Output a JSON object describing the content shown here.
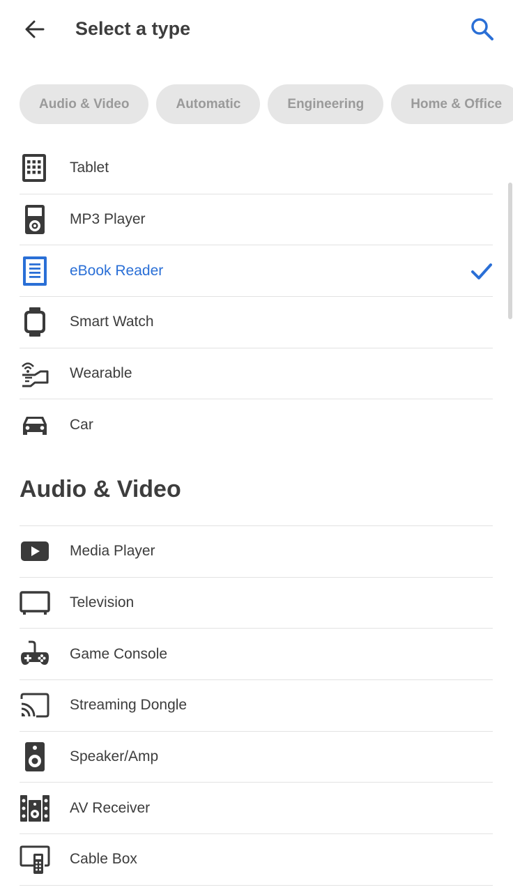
{
  "header": {
    "title": "Select a type",
    "back_icon": "arrow-left-icon",
    "search_icon": "search-icon"
  },
  "chips": [
    {
      "label": "Audio & Video"
    },
    {
      "label": "Automatic"
    },
    {
      "label": "Engineering"
    },
    {
      "label": "Home & Office"
    }
  ],
  "types": [
    {
      "label": "Tablet",
      "icon": "tablet-icon"
    },
    {
      "label": "MP3 Player",
      "icon": "mp3-player-icon"
    },
    {
      "label": "eBook Reader",
      "icon": "ebook-reader-icon",
      "selected": true
    },
    {
      "label": "Smart Watch",
      "icon": "smart-watch-icon"
    },
    {
      "label": "Wearable",
      "icon": "wearable-icon"
    },
    {
      "label": "Car",
      "icon": "car-icon"
    }
  ],
  "sections": [
    {
      "title": "Audio & Video",
      "items": [
        {
          "label": "Media Player",
          "icon": "media-player-icon"
        },
        {
          "label": "Television",
          "icon": "television-icon"
        },
        {
          "label": "Game Console",
          "icon": "game-console-icon"
        },
        {
          "label": "Streaming Dongle",
          "icon": "cast-icon"
        },
        {
          "label": "Speaker/Amp",
          "icon": "speaker-icon"
        },
        {
          "label": "AV Receiver",
          "icon": "av-receiver-icon"
        },
        {
          "label": "Cable Box",
          "icon": "cable-box-icon"
        }
      ]
    }
  ],
  "colors": {
    "accent": "#2a6fd6",
    "text": "#3c3c3c",
    "chip_bg": "#e6e6e6",
    "chip_text": "#9a9a9a",
    "divider": "#e2e2e2"
  }
}
